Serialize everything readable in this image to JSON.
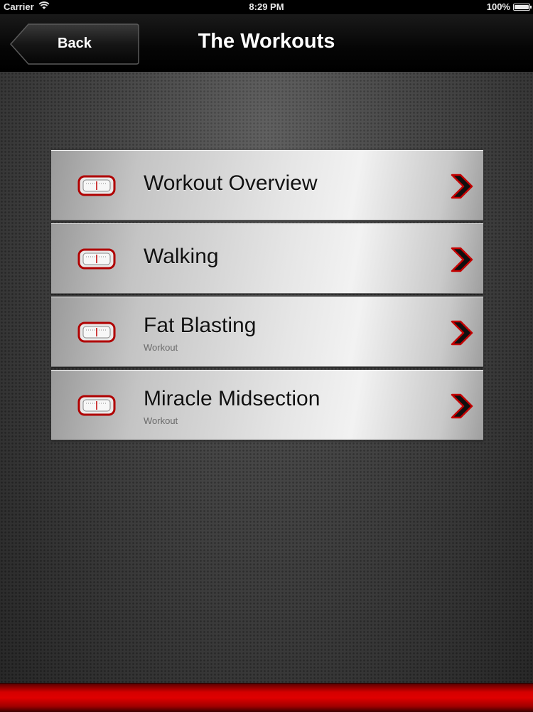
{
  "status_bar": {
    "carrier": "Carrier",
    "time": "8:29 PM",
    "battery": "100%"
  },
  "nav": {
    "back_label": "Back",
    "title": "The Workouts"
  },
  "menu": {
    "items": [
      {
        "title": "Workout Overview",
        "subtitle": "",
        "icon": "scale-icon"
      },
      {
        "title": "Walking",
        "subtitle": "",
        "icon": "scale-icon"
      },
      {
        "title": "Fat Blasting",
        "subtitle": "Workout",
        "icon": "scale-icon"
      },
      {
        "title": "Miracle Midsection",
        "subtitle": "Workout",
        "icon": "scale-icon"
      }
    ]
  },
  "colors": {
    "accent_red": "#d40000",
    "nav_background": "#000000",
    "item_text": "#111111"
  }
}
